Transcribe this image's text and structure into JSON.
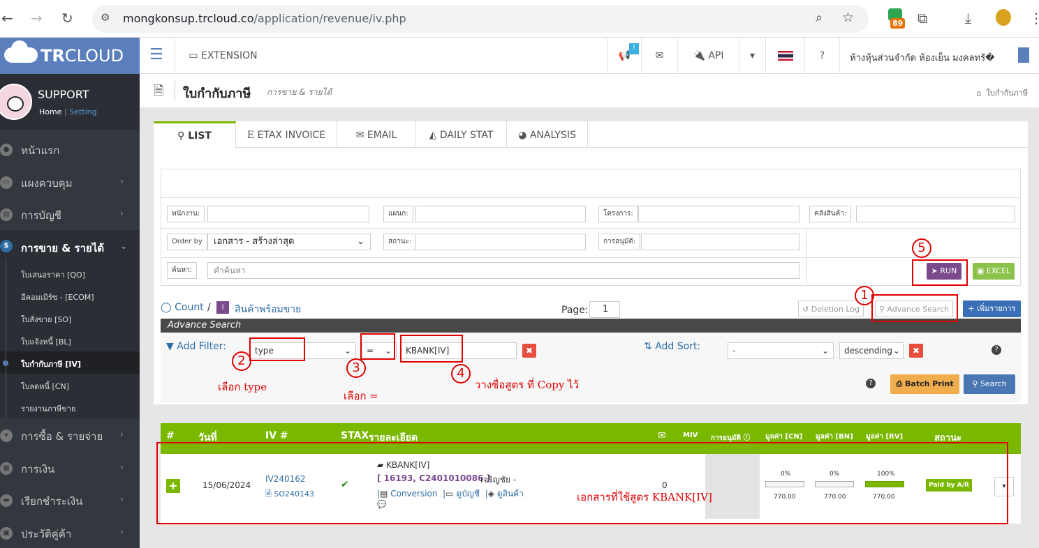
{
  "browser": {
    "url_host": "mongkonsup.trcloud.co",
    "url_path": "/application/revenue/iv.php",
    "ext_badge": "89"
  },
  "sidebar": {
    "logo_bold": "TR",
    "logo_rest": "CLOUD",
    "user": "SUPPORT",
    "home": "Home",
    "sep": "|",
    "setting": "Setting",
    "menu": [
      {
        "label": "หน้าแรก"
      },
      {
        "label": "แผงควบคุม"
      },
      {
        "label": "การบัญชี"
      },
      {
        "label": "การขาย & รายได้"
      }
    ],
    "sub": [
      {
        "label": "ใบเสนอราคา [QO]"
      },
      {
        "label": "อีคอมเมิร์ซ - [ECOM]"
      },
      {
        "label": "ใบสั่งขาย [SO]"
      },
      {
        "label": "ใบแจ้งหนี้ [BL]"
      },
      {
        "label": "ใบกำกับภาษี [IV]"
      },
      {
        "label": "ใบลดหนี้ [CN]"
      },
      {
        "label": "รายงานภาษีขาย"
      }
    ],
    "menu2": [
      {
        "label": "การซื้อ & รายจ่าย"
      },
      {
        "label": "การเงิน"
      },
      {
        "label": "เรียกชำระเงิน"
      },
      {
        "label": "ประวัติคู่ค้า"
      }
    ]
  },
  "header": {
    "extension": "EXTENSION",
    "notify_badge": "!",
    "api": "API",
    "company": "ห้างหุ้นส่วนจำกัด ห้องเย็น มงคลทรั�"
  },
  "title": {
    "main": "ใบกำกับภาษี",
    "sub": "การขาย & รายได้",
    "crumb": "ใบกำกับภาษี"
  },
  "tabs": [
    "LIST",
    "ETAX INVOICE",
    "EMAIL",
    "DAILY STAT",
    "ANALYSIS"
  ],
  "filters": {
    "staff": "พนักงาน:",
    "dept": "แผนก:",
    "project": "โครงการ:",
    "warehouse": "คลังสินค้า:",
    "order_by": "Order by",
    "order_value": "เอกสาร - สร้างล่าสุด",
    "status": "สถานะ:",
    "approval": "การอนุมัติ:",
    "search_lbl": "ค้นหา:",
    "search_placeholder": "คำค้นหา",
    "run": "RUN",
    "excel": "EXCEL"
  },
  "listbar": {
    "count": "Count",
    "slash": "/",
    "ready": "สินค้าพร้อมขาย",
    "page_lbl": "Page:",
    "page_val": "1",
    "deletion_log": "Deletion Log",
    "adv_search": "Advance Search",
    "add_item": "+ เพิ่มรายการ"
  },
  "advance": {
    "heading": "Advance Search",
    "add_filter": "Add Filter:",
    "field": "type",
    "op": "=",
    "value": "KBANK[IV]",
    "add_sort": "Add Sort:",
    "sort_field": "-",
    "sort_dir": "descending",
    "batch_print": "Batch Print",
    "search": "Search"
  },
  "table": {
    "headers": {
      "num": "#",
      "date": "วันที่",
      "iv": "IV #",
      "stax": "STAX",
      "detail": "รายละเอียด",
      "miv": "MIV",
      "approve": "การอนุมัติ",
      "cn": "มูลค่า [CN]",
      "bn": "มูลค่า [BN]",
      "rv": "มูลค่า [RV]",
      "status": "สถานะ"
    },
    "row": {
      "date": "15/06/2024",
      "iv": "IV240162",
      "so": "SO240143",
      "doc": "KBANK[IV]",
      "ref": "[ 16193, C2401010086 ]",
      "cust": "เจริญชัย -",
      "conv": "Conversion",
      "view_acc": "ดูบัญชี",
      "view_prod": "ดูสินค้า",
      "mail": "0",
      "cn_pct": "0%",
      "cn_val": "770.00",
      "bn_pct": "0%",
      "bn_val": "770.00",
      "rv_pct": "100%",
      "rv_val": "770.00",
      "status": "Paid by A/R"
    }
  },
  "annotations": {
    "n1": "1",
    "n2": "2",
    "n3": "3",
    "n4": "4",
    "n5": "5",
    "note2": "เลือก type",
    "note3": "เลือก =",
    "note4": "วางชื่อสูตร ที่ Copy ไว้",
    "note_row": "เอกสารที่ใช้สูตร KBANK[IV]"
  },
  "colors": {
    "green": "#7ab800",
    "blue": "#5b7fbd",
    "purple": "#7b4a8c",
    "annot": "#e00000"
  }
}
